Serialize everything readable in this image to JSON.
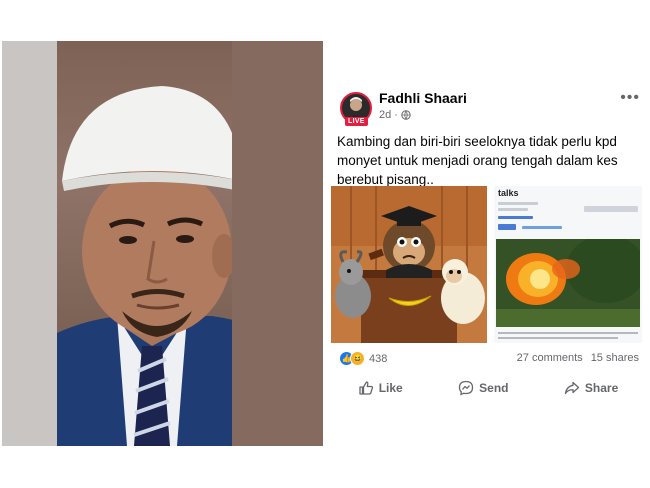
{
  "post": {
    "author": "Fadhli Shaari",
    "live_badge": "LIVE",
    "time": "2d",
    "more_label": "•••",
    "text": "Kambing dan biri-biri seeloknya tidak perlu kpd monyet untuk menjadi orang tengah dalam kes berebut pisang..",
    "shared_image": {
      "site_name": "talks"
    },
    "reaction_count": "438",
    "comments": "27 comments",
    "shares": "15 shares",
    "actions": {
      "like": "Like",
      "send": "Send",
      "share": "Share"
    }
  },
  "colors": {
    "live_red": "#e41e3f",
    "like_blue": "#1877f2",
    "haha_yellow": "#f7b125",
    "meta_gray": "#65676b"
  }
}
